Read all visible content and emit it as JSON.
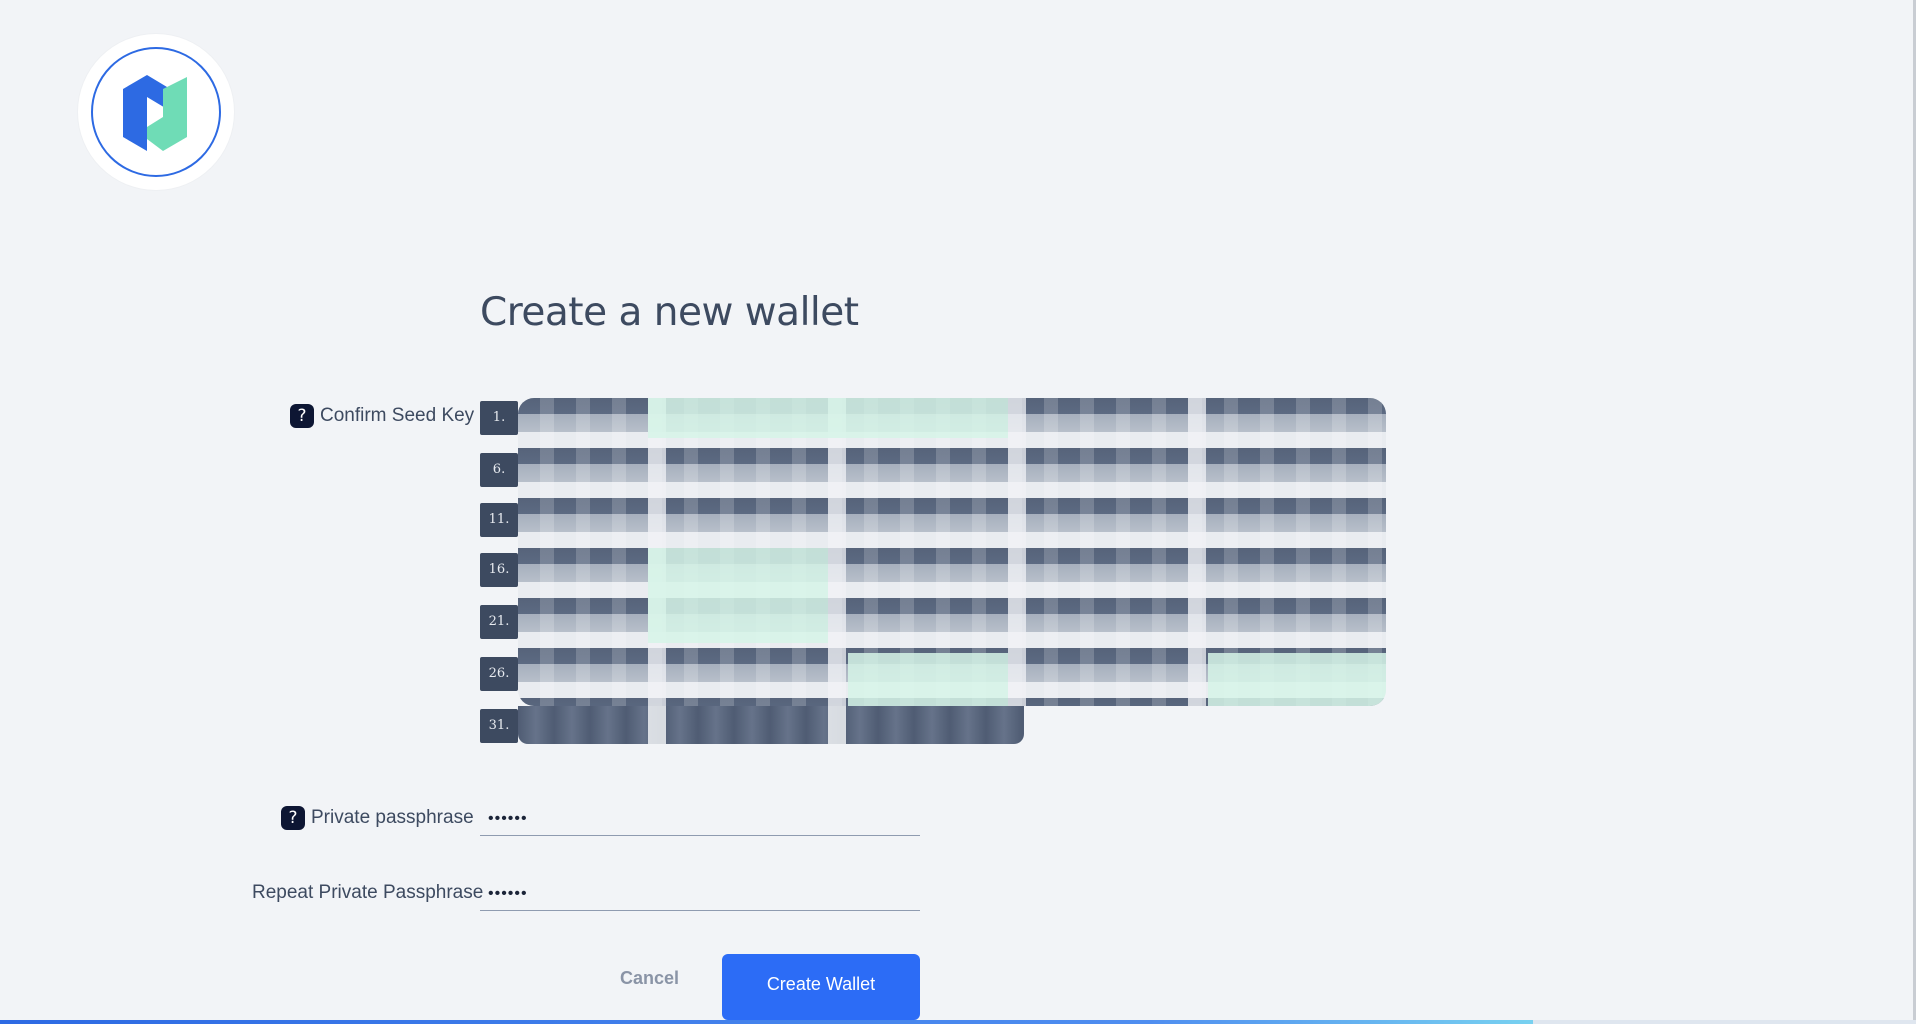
{
  "app": {
    "logo": "decred-style-logo"
  },
  "page": {
    "title": "Create a new wallet"
  },
  "seed": {
    "label": "Confirm Seed Key",
    "help_icon": "?",
    "row_numbers": [
      "1.",
      "6.",
      "11.",
      "16.",
      "21.",
      "26.",
      "31."
    ]
  },
  "passphrase": {
    "label": "Private passphrase",
    "help_icon": "?",
    "value": "••••••"
  },
  "repeat_passphrase": {
    "label": "Repeat Private Passphrase",
    "value": "••••••"
  },
  "actions": {
    "cancel_label": "Cancel",
    "create_label": "Create Wallet"
  },
  "colors": {
    "accent": "#2c6cf6",
    "text": "#3d4a60",
    "background": "#f2f4f7"
  }
}
